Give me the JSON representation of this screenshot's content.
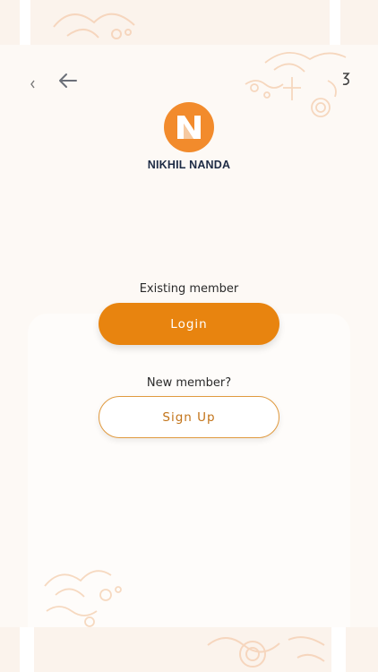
{
  "brand": {
    "name": "NIKHIL NANDA",
    "mark_letter": "N",
    "mark_color": "#f28b2c",
    "text_color": "#1d2b45"
  },
  "navigation": {
    "back_icon": "arrow-left-icon"
  },
  "existing_member": {
    "prompt": "Existing member",
    "button_label": "Login",
    "button_color": "#e8840f"
  },
  "new_member": {
    "prompt": "New member?",
    "button_label": "Sign Up",
    "button_text_color": "#c27318"
  },
  "theme": {
    "background": "#fdf9f5",
    "pattern_color": "#f5c9a6"
  }
}
